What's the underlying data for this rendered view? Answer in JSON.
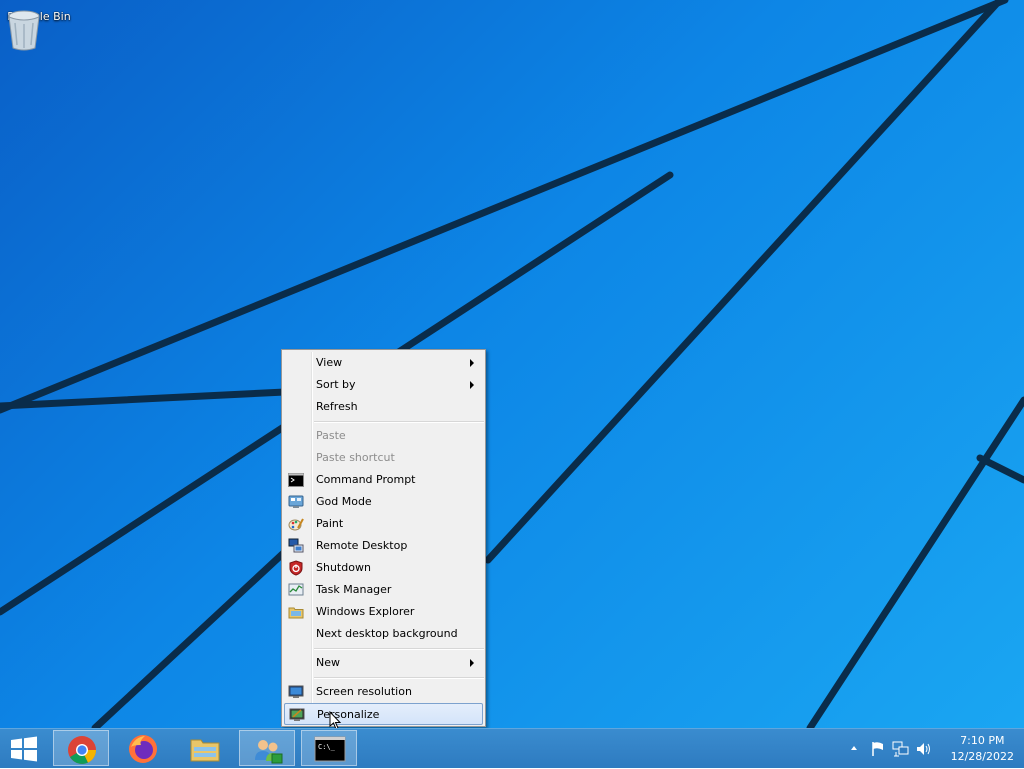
{
  "desktop": {
    "icons": [
      {
        "label": "Recycle Bin",
        "icon": "recycle-bin-icon"
      }
    ]
  },
  "context_menu": {
    "items": [
      {
        "label": "View",
        "submenu": true
      },
      {
        "label": "Sort by",
        "submenu": true
      },
      {
        "label": "Refresh"
      },
      {
        "label": "Paste",
        "disabled": true
      },
      {
        "label": "Paste shortcut",
        "disabled": true
      },
      {
        "label": "Command Prompt",
        "icon": "command-prompt-icon"
      },
      {
        "label": "God Mode",
        "icon": "god-mode-icon"
      },
      {
        "label": "Paint",
        "icon": "paint-icon"
      },
      {
        "label": "Remote Desktop",
        "icon": "remote-desktop-icon"
      },
      {
        "label": "Shutdown",
        "icon": "shutdown-icon"
      },
      {
        "label": "Task Manager",
        "icon": "task-manager-icon"
      },
      {
        "label": "Windows Explorer",
        "icon": "windows-explorer-icon"
      },
      {
        "label": "Next desktop background"
      },
      {
        "label": "New",
        "submenu": true
      },
      {
        "label": "Screen resolution",
        "icon": "screen-resolution-icon"
      },
      {
        "label": "Personalize",
        "icon": "personalize-icon",
        "highlighted": true
      }
    ]
  },
  "taskbar": {
    "start_icon": "windows-start-icon",
    "pinned": [
      {
        "name": "chrome",
        "icon": "chrome-icon",
        "active": true
      },
      {
        "name": "firefox",
        "icon": "firefox-icon"
      },
      {
        "name": "file-explorer",
        "icon": "file-explorer-icon"
      },
      {
        "name": "users",
        "icon": "users-icon",
        "active": true
      },
      {
        "name": "command-prompt",
        "icon": "command-prompt-icon",
        "active": true,
        "label": "C:\\_"
      }
    ],
    "tray": {
      "icons": [
        "show-hidden-icons-icon",
        "flag-icon",
        "network-icon",
        "volume-icon"
      ],
      "time": "7:10 PM",
      "date": "12/28/2022"
    }
  },
  "colors": {
    "desktop_blue": "#0d86e6",
    "taskbar_blue": "#2e7bc0",
    "menu_bg": "#f0f0f0",
    "menu_highlight_border": "#7da2ce"
  }
}
